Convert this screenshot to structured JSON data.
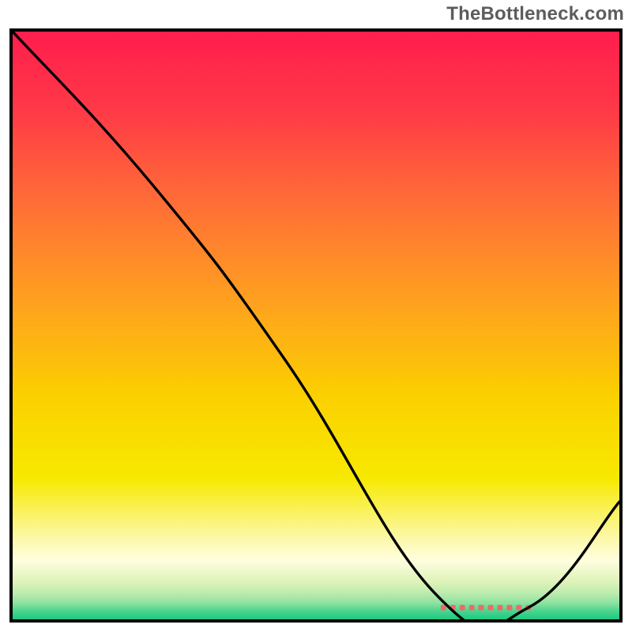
{
  "watermark": "TheBottleneck.com",
  "chart_data": {
    "type": "line",
    "title": "",
    "xlabel": "",
    "ylabel": "",
    "xlim": [
      0,
      100
    ],
    "ylim": [
      0,
      100
    ],
    "grid": false,
    "legend": false,
    "x": [
      0,
      23,
      45,
      70,
      85,
      100
    ],
    "y": [
      100,
      74,
      44,
      4,
      2,
      20
    ],
    "background_type": "vertical-gradient-red-yellow-green",
    "gradient_stops": [
      {
        "stop": 0.0,
        "color": "#ff1d4d"
      },
      {
        "stop": 0.13,
        "color": "#ff3847"
      },
      {
        "stop": 0.28,
        "color": "#ff6a38"
      },
      {
        "stop": 0.45,
        "color": "#ff9e20"
      },
      {
        "stop": 0.62,
        "color": "#fbd000"
      },
      {
        "stop": 0.76,
        "color": "#f7e900"
      },
      {
        "stop": 0.86,
        "color": "#fcf8a6"
      },
      {
        "stop": 0.9,
        "color": "#fffedf"
      },
      {
        "stop": 0.935,
        "color": "#dff3ba"
      },
      {
        "stop": 0.955,
        "color": "#bdecae"
      },
      {
        "stop": 0.972,
        "color": "#8de2a0"
      },
      {
        "stop": 0.985,
        "color": "#4fd58f"
      },
      {
        "stop": 1.0,
        "color": "#1bc97f"
      }
    ],
    "marker": {
      "x_center": 78,
      "width": 14,
      "y": 2,
      "color": "#ed6a66"
    }
  }
}
